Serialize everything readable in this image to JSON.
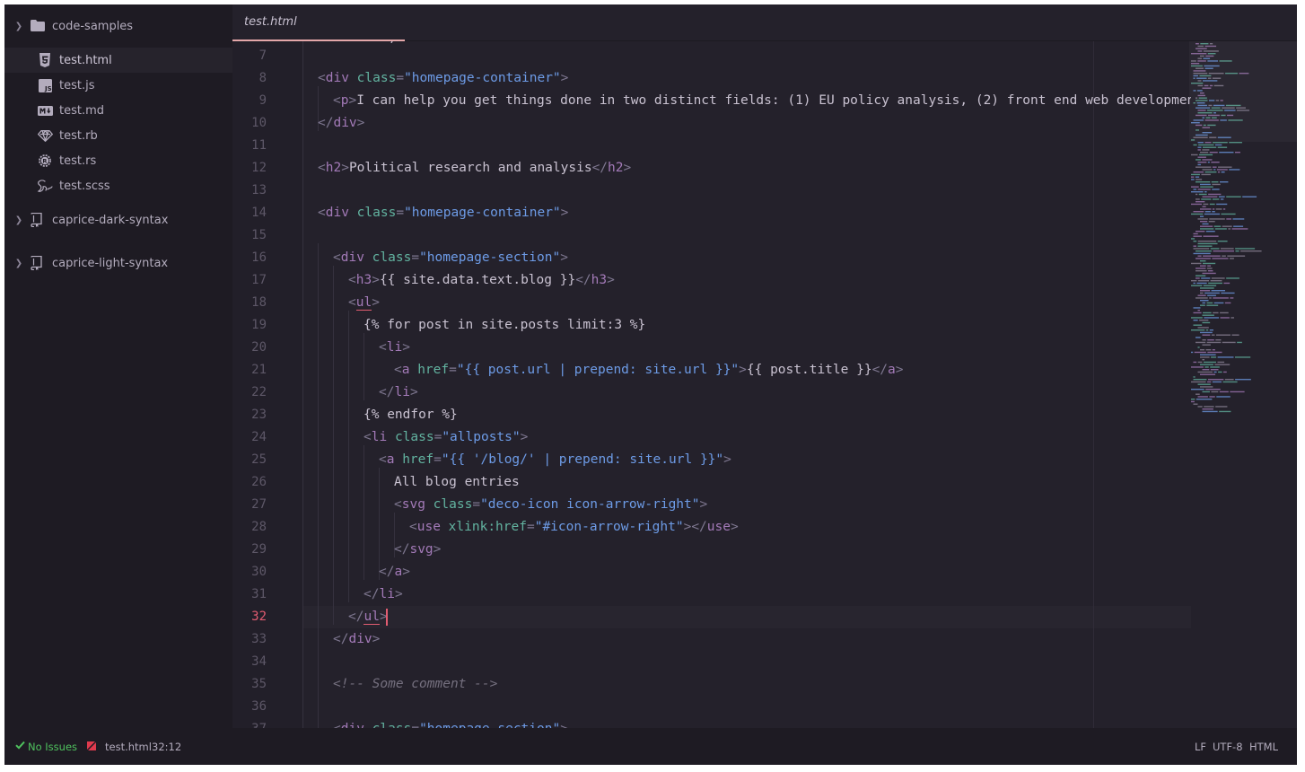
{
  "sidebar": {
    "project": {
      "name": "code-samples",
      "expanded": true
    },
    "files": [
      {
        "name": "test.html",
        "icon": "html5-icon",
        "selected": true
      },
      {
        "name": "test.js",
        "icon": "js-file-icon"
      },
      {
        "name": "test.md",
        "icon": "markdown-icon"
      },
      {
        "name": "test.rb",
        "icon": "ruby-icon"
      },
      {
        "name": "test.rs",
        "icon": "rust-icon"
      },
      {
        "name": "test.scss",
        "icon": "sass-icon"
      }
    ],
    "repos": [
      {
        "name": "caprice-dark-syntax",
        "icon": "repo-icon"
      },
      {
        "name": "caprice-light-syntax",
        "icon": "repo-icon"
      }
    ]
  },
  "tabs": [
    {
      "label": "test.html",
      "active": true
    }
  ],
  "editor": {
    "line_numbers": [
      "7",
      "8",
      "9",
      "10",
      "11",
      "12",
      "13",
      "14",
      "15",
      "16",
      "17",
      "18",
      "19",
      "20",
      "21",
      "22",
      "23",
      "24",
      "25",
      "26",
      "27",
      "28",
      "29",
      "30",
      "31",
      "32",
      "33",
      "34",
      "35",
      "36",
      "37"
    ],
    "current_line": "32"
  },
  "status_bar": {
    "linter": "No Issues",
    "file": "test.html",
    "cursor_position": "32:12",
    "line_ending": "LF",
    "encoding": "UTF-8",
    "grammar": "HTML"
  },
  "colors": {
    "background": "#24212b",
    "sidebar": "#1e1b23",
    "accent": "#e25c71",
    "tag": "#a37ab8",
    "attribute": "#62b3a0",
    "string": "#6d9be6",
    "ok": "#4fc25e"
  }
}
